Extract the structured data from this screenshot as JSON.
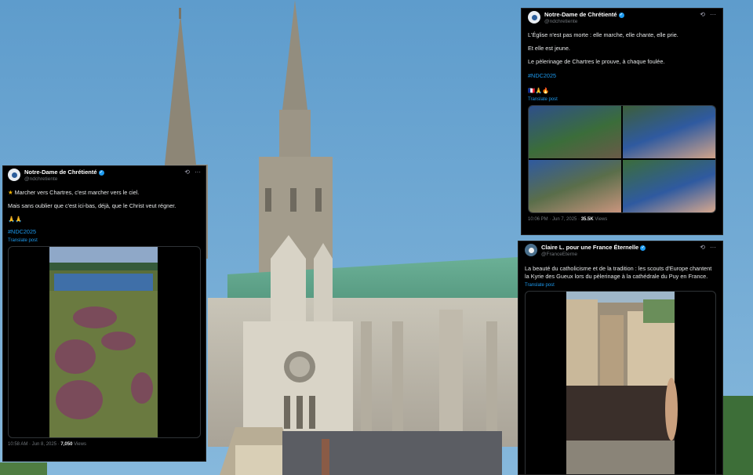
{
  "tweet1": {
    "display_name": "Notre-Dame de Chrétienté",
    "handle": "@ndchretiente",
    "line1": "Marcher vers Chartres, c'est marcher vers le ciel.",
    "line1_icon": "star-emoji",
    "line2": "Mais sans oublier que c'est ici-bas, déjà, que le Christ veut régner.",
    "emojis": "🙏🙏",
    "hashtag": "#NDC2025",
    "translate": "Translate post",
    "time": "10:58 AM · Jun 8, 2025 ·",
    "views_count": "7,050",
    "views_label": "Views"
  },
  "tweet2": {
    "display_name": "Notre-Dame de Chrétienté",
    "handle": "@ndchretiente",
    "line1": "L'Église n'est pas morte : elle marche, elle chante, elle prie.",
    "line2": "Et elle est jeune.",
    "line3": "Le pèlerinage de Chartres le prouve, à chaque foulée.",
    "hashtag": "#NDC2025",
    "emojis": "🇫🇷🙏🔥",
    "translate": "Translate post",
    "time": "10:06 PM · Jun 7, 2025 ·",
    "views_count": "35.5K",
    "views_label": "Views"
  },
  "tweet3": {
    "display_name": "Claire L. pour une France Éternelle",
    "handle": "@FranceEterne",
    "text": "La beauté du catholicisme et de la tradition : les scouts d'Europe chantent la Kyrie des Gueux lors du pèlerinage à la cathédrale du Puy en France.",
    "translate": "Translate post"
  },
  "icons": {
    "verified": "verified-badge-icon",
    "grok": "grok-icon",
    "more": "more-options-icon"
  },
  "colors": {
    "card_bg": "#000000",
    "link": "#1d9bf0",
    "sky": "#6aa3cf",
    "roof": "#5fa48a"
  }
}
